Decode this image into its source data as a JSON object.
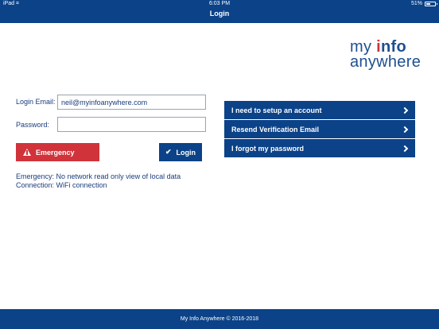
{
  "status_bar": {
    "device": "iPad",
    "time": "6:03 PM",
    "battery_text": "51%",
    "battery_level": 0.51
  },
  "nav": {
    "title": "Login"
  },
  "logo": {
    "line1_a": "my ",
    "line1_i": "i",
    "line1_b": "nfo",
    "line2": "anywhere"
  },
  "form": {
    "email_label": "Login Email:",
    "email_value": "neil@myinfoanywhere.com",
    "password_label": "Password:",
    "password_value": ""
  },
  "buttons": {
    "emergency": "Emergency",
    "login": "Login"
  },
  "info": {
    "emergency_note": "Emergency: No network read only view of local data",
    "connection_note": "Connection: WiFi connection"
  },
  "menu": [
    {
      "label": "I need to setup an account"
    },
    {
      "label": "Resend Verification Email"
    },
    {
      "label": "I forgot my password"
    }
  ],
  "footer": {
    "text": "My Info Anywhere © 2016-2018"
  },
  "colors": {
    "brand": "#0b4288",
    "emergency": "#d0333a"
  }
}
